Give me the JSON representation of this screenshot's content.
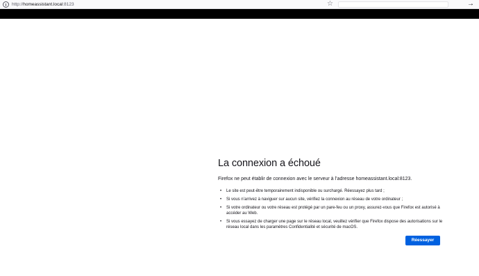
{
  "browser": {
    "url_scheme": "http://",
    "url_host": "homeassistant.local",
    "url_port": ":8123",
    "icons": {
      "info": "info-icon",
      "bookmark": "star-icon",
      "search": "search-icon",
      "go": "arrow-right-icon"
    },
    "search_value": ""
  },
  "error_page": {
    "title": "La connexion a échoué",
    "description": "Firefox ne peut établir de connexion avec le serveur à l’adresse homeassistant.local:8123.",
    "suggestions": [
      "Le site est peut-être temporairement indisponible ou surchargé. Réessayez plus tard ;",
      "Si vous n’arrivez à naviguer sur aucun site, vérifiez la connexion au réseau de votre ordinateur ;",
      "Si votre ordinateur ou votre réseau est protégé par un pare-feu ou un proxy, assurez-vous que Firefox est autorisé à accéder au Web.",
      "Si vous essayez de charger une page sur le réseau local, veuillez vérifier que Firefox dispose des autorisations sur le réseau local dans les paramètres Confidentialité et sécurité de macOS."
    ],
    "retry_label": "Réessayer"
  },
  "colors": {
    "accent": "#0061e0",
    "text": "#15141a",
    "black_bar": "#000000"
  }
}
